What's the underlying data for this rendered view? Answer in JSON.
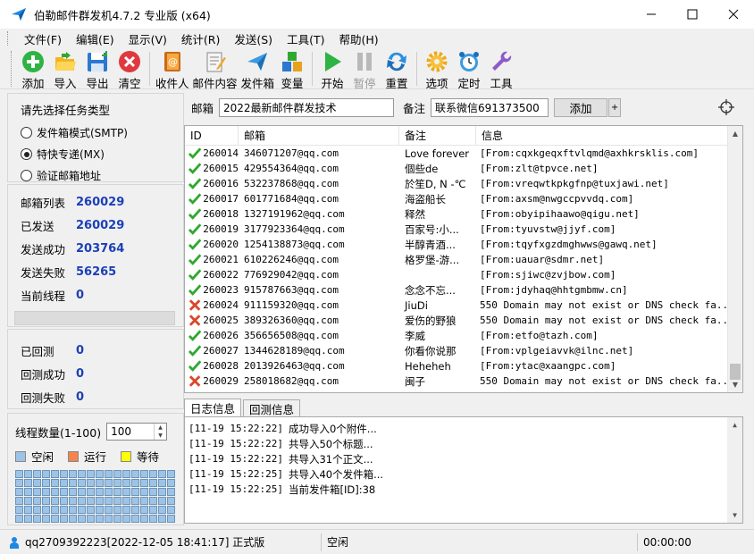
{
  "window": {
    "title": "伯勒邮件群发机4.7.2 专业版 (x64)",
    "controls": [
      "minimize",
      "maximize",
      "close"
    ]
  },
  "menu": [
    "文件(F)",
    "编辑(E)",
    "显示(V)",
    "统计(R)",
    "发送(S)",
    "工具(T)",
    "帮助(H)"
  ],
  "toolbar": [
    {
      "label": "添加",
      "icon": "add-icon"
    },
    {
      "label": "导入",
      "icon": "folder-open-icon"
    },
    {
      "label": "导出",
      "icon": "save-icon"
    },
    {
      "label": "清空",
      "icon": "clear-icon"
    },
    {
      "label": "收件人",
      "icon": "address-book-icon"
    },
    {
      "label": "邮件内容",
      "icon": "edit-doc-icon"
    },
    {
      "label": "发件箱",
      "icon": "paper-plane-icon"
    },
    {
      "label": "变量",
      "icon": "variable-icon"
    },
    {
      "label": "开始",
      "icon": "play-icon"
    },
    {
      "label": "暂停",
      "icon": "pause-icon"
    },
    {
      "label": "重置",
      "icon": "reset-icon"
    },
    {
      "label": "选项",
      "icon": "gear-icon"
    },
    {
      "label": "定时",
      "icon": "alarm-clock-icon"
    },
    {
      "label": "工具",
      "icon": "wrench-icon"
    }
  ],
  "task": {
    "title": "请先选择任务类型",
    "options": [
      "发件箱模式(SMTP)",
      "特快专递(MX)",
      "验证邮箱地址"
    ],
    "selected_index": 1
  },
  "stats": [
    {
      "label": "邮箱列表",
      "value": "260029"
    },
    {
      "label": "已发送",
      "value": "260029"
    },
    {
      "label": "发送成功",
      "value": "203764"
    },
    {
      "label": "发送失败",
      "value": "56265"
    },
    {
      "label": "当前线程",
      "value": "0"
    }
  ],
  "bounce": [
    {
      "label": "已回测",
      "value": "0"
    },
    {
      "label": "回测成功",
      "value": "0"
    },
    {
      "label": "回测失败",
      "value": "0"
    }
  ],
  "thread": {
    "label": "线程数量(1-100)",
    "value": "100",
    "legend": [
      {
        "label": "空闲",
        "color": "#9dc3e6"
      },
      {
        "label": "运行",
        "color": "#f4844c"
      },
      {
        "label": "等待",
        "color": "#ffff00"
      }
    ],
    "slots": 108
  },
  "compose": {
    "mailbox_label": "邮箱",
    "mailbox_value": "2022最新邮件群发技术",
    "note_label": "备注",
    "note_value": "联系微信691373500",
    "add_button": "添加",
    "plus_button": "+"
  },
  "list": {
    "columns": [
      "ID",
      "邮箱",
      "备注",
      "信息"
    ],
    "rows": [
      {
        "status": "ok",
        "id": "260014",
        "email": "346071207@qq.com",
        "note": "Love forever",
        "info": "[From:cqxkgeqxftvlqmd@axhkrsklis.com]"
      },
      {
        "status": "ok",
        "id": "260015",
        "email": "429554364@qq.com",
        "note": "個些de",
        "info": "[From:zlt@tpvce.net]"
      },
      {
        "status": "ok",
        "id": "260016",
        "email": "532237868@qq.com",
        "note": " 於笙D, N -℃",
        "info": "[From:vreqwtkpkgfnp@tuxjawi.net]"
      },
      {
        "status": "ok",
        "id": "260017",
        "email": "601771684@qq.com",
        "note": "海盗船长",
        "info": "[From:axsm@nwgccpvvdq.com]"
      },
      {
        "status": "ok",
        "id": "260018",
        "email": "1327191962@qq.com",
        "note": "释然",
        "info": "[From:obyipihaawo@qigu.net]"
      },
      {
        "status": "ok",
        "id": "260019",
        "email": "3177923364@qq.com",
        "note": "百家号:小...",
        "info": "[From:tyuvstw@jjyf.com]"
      },
      {
        "status": "ok",
        "id": "260020",
        "email": "1254138873@qq.com",
        "note": "半醇青酒...",
        "info": "[From:tqyfxgzdmghwws@gawq.net]"
      },
      {
        "status": "ok",
        "id": "260021",
        "email": "610226246@qq.com",
        "note": "格罗堡-游...",
        "info": "[From:uauar@sdmr.net]"
      },
      {
        "status": "ok",
        "id": "260022",
        "email": "776929042@qq.com",
        "note": "",
        "info": "[From:sjiwc@zvjbow.com]"
      },
      {
        "status": "ok",
        "id": "260023",
        "email": "915787663@qq.com",
        "note": "念念不忘...",
        "info": "[From:jdyhaq@hhtgmbmw.cn]"
      },
      {
        "status": "fail",
        "id": "260024",
        "email": "911159320@qq.com",
        "note": "JiuDi",
        "info": "550 Domain may not exist or DNS check fa..."
      },
      {
        "status": "fail",
        "id": "260025",
        "email": "389326360@qq.com",
        "note": "爱伤的野狼",
        "info": "550 Domain may not exist or DNS check fa..."
      },
      {
        "status": "ok",
        "id": "260026",
        "email": "356656508@qq.com",
        "note": "李威",
        "info": "[From:etfo@tazh.com]"
      },
      {
        "status": "ok",
        "id": "260027",
        "email": "1344628189@qq.com",
        "note": "你看你说那",
        "info": "[From:vplgeiavvk@ilnc.net]"
      },
      {
        "status": "ok",
        "id": "260028",
        "email": "2013926463@qq.com",
        "note": "Heheheh",
        "info": "[From:ytac@xaangpc.com]"
      },
      {
        "status": "fail",
        "id": "260029",
        "email": "258018682@qq.com",
        "note": "闽子",
        "info": "550 Domain may not exist or DNS check fa..."
      }
    ]
  },
  "tabs": [
    "日志信息",
    "回测信息"
  ],
  "log": [
    {
      "time": "[11-19 15:22:22]",
      "msg": "成功导入0个附件..."
    },
    {
      "time": "[11-19 15:22:22]",
      "msg": "共导入50个标题..."
    },
    {
      "time": "[11-19 15:22:22]",
      "msg": "共导入31个正文..."
    },
    {
      "time": "[11-19 15:22:25]",
      "msg": "共导入40个发件箱..."
    },
    {
      "time": "[11-19 15:22:25]",
      "msg": "当前发件箱[ID]:38"
    }
  ],
  "status": {
    "user": "qq2709392223[2022-12-05 18:41:17] 正式版",
    "state": "空闲",
    "timer": "00:00:00"
  },
  "colors": {
    "accent_blue": "#1c3fb8",
    "ok_green": "#2fa82f",
    "fail_red": "#d9482b"
  }
}
